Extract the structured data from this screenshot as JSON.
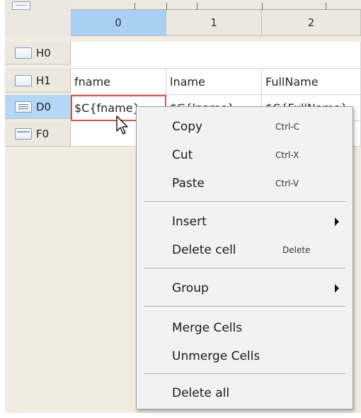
{
  "columns": [
    "0",
    "1",
    "2"
  ],
  "rows": [
    {
      "label": "H0",
      "cells": [
        "",
        "",
        ""
      ]
    },
    {
      "label": "H1",
      "cells": [
        "fname",
        "lname",
        "FullName"
      ]
    },
    {
      "label": "D0",
      "cells": [
        "$C{fname}",
        "$C{lname}",
        "$C{FullName}"
      ]
    },
    {
      "label": "F0",
      "cells": [
        "",
        "",
        ""
      ]
    }
  ],
  "context_menu": {
    "copy": {
      "label": "Copy",
      "shortcut": "Ctrl-C"
    },
    "cut": {
      "label": "Cut",
      "shortcut": "Ctrl-X"
    },
    "paste": {
      "label": "Paste",
      "shortcut": "Ctrl-V"
    },
    "insert": {
      "label": "Insert"
    },
    "delete_cell": {
      "label": "Delete cell",
      "shortcut": "Delete"
    },
    "group": {
      "label": "Group"
    },
    "merge_cells": {
      "label": "Merge Cells"
    },
    "unmerge_cells": {
      "label": "Unmerge Cells"
    },
    "delete_all": {
      "label": "Delete all"
    }
  },
  "colors": {
    "selected_header": "#a9d0f4",
    "active_cell_border": "#d9534f",
    "menu_background": "#f2f2f2"
  }
}
